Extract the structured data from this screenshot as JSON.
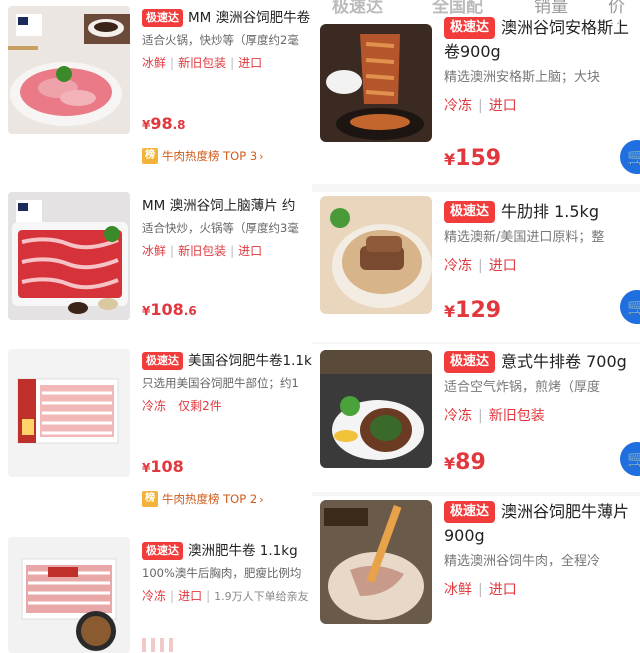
{
  "header": {
    "tabs": [
      {
        "label": "极速达"
      },
      {
        "label": "全国配"
      },
      {
        "label": "销量"
      },
      {
        "label": "价格"
      }
    ]
  },
  "left_products": [
    {
      "title": "MM 澳洲谷饲肥牛卷",
      "desc": "适合火锅，快炒等（厚度约2毫",
      "tags": [
        "冰鲜",
        "新旧包装",
        "进口"
      ],
      "price_int": "98",
      "price_dec": ".8",
      "rank": "牛肉热度榜 TOP 3",
      "badge": "极速达",
      "image_icon": "beef-rolls-plate-photo"
    },
    {
      "title": "MM 澳洲谷饲上脑薄片 约",
      "desc": "适合快炒，火锅等（厚度约3毫",
      "tags": [
        "冰鲜",
        "新旧包装",
        "进口"
      ],
      "price_int": "108",
      "price_dec": ".6",
      "image_icon": "beef-slices-tray-photo"
    },
    {
      "title": "美国谷饲肥牛卷1.1k",
      "desc": "只选用美国谷饲肥牛部位；约1",
      "tags": [
        "冷冻",
        "仅剩2件"
      ],
      "price_int": "108",
      "price_dec": "",
      "rank": "牛肉热度榜 TOP 2",
      "badge": "极速达",
      "image_icon": "beef-roll-package-photo"
    },
    {
      "title": "澳洲肥牛卷 1.1kg",
      "desc": "100%澳牛后胸肉，肥瘦比例均",
      "tags": [
        "冷冻",
        "进口"
      ],
      "extra": "1.9万人下单给亲友",
      "badge": "极速达",
      "image_icon": "beef-roll-box-photo"
    }
  ],
  "rank_icon": "榜",
  "right_products": [
    {
      "title": "澳洲谷饲安格斯上",
      "title2": "卷900g",
      "desc": "精选澳洲安格斯上脑；大块",
      "tags": [
        "冷冻",
        "进口"
      ],
      "price": "159",
      "badge": "极速达",
      "image_icon": "grilled-beef-rice-photo"
    },
    {
      "title": "牛肋排 1.5kg",
      "desc": "精选澳新/美国进口原料；整",
      "tags": [
        "冷冻",
        "进口"
      ],
      "price": "129",
      "badge": "极速达",
      "image_icon": "rib-soup-photo"
    },
    {
      "title": "意式牛排卷 700g",
      "desc": "适合空气炸锅，煎烤（厚度",
      "tags": [
        "冷冻",
        "新旧包装"
      ],
      "price": "89",
      "badge": "极速达",
      "image_icon": "steak-roll-photo"
    },
    {
      "title": "澳洲谷饲肥牛薄片",
      "title2": "900g",
      "desc": "精选澳洲谷饲牛肉，全程冷",
      "tags": [
        "冰鲜",
        "进口"
      ],
      "badge": "极速达",
      "image_icon": "thin-beef-slices-photo"
    }
  ],
  "currency": "¥",
  "cart_icon": "cart-icon",
  "colors": {
    "accent_red": "#f23c3c",
    "price_red": "#e0383e",
    "rank_orange": "#cf5a1a",
    "cart_blue": "#1f6fe0"
  }
}
